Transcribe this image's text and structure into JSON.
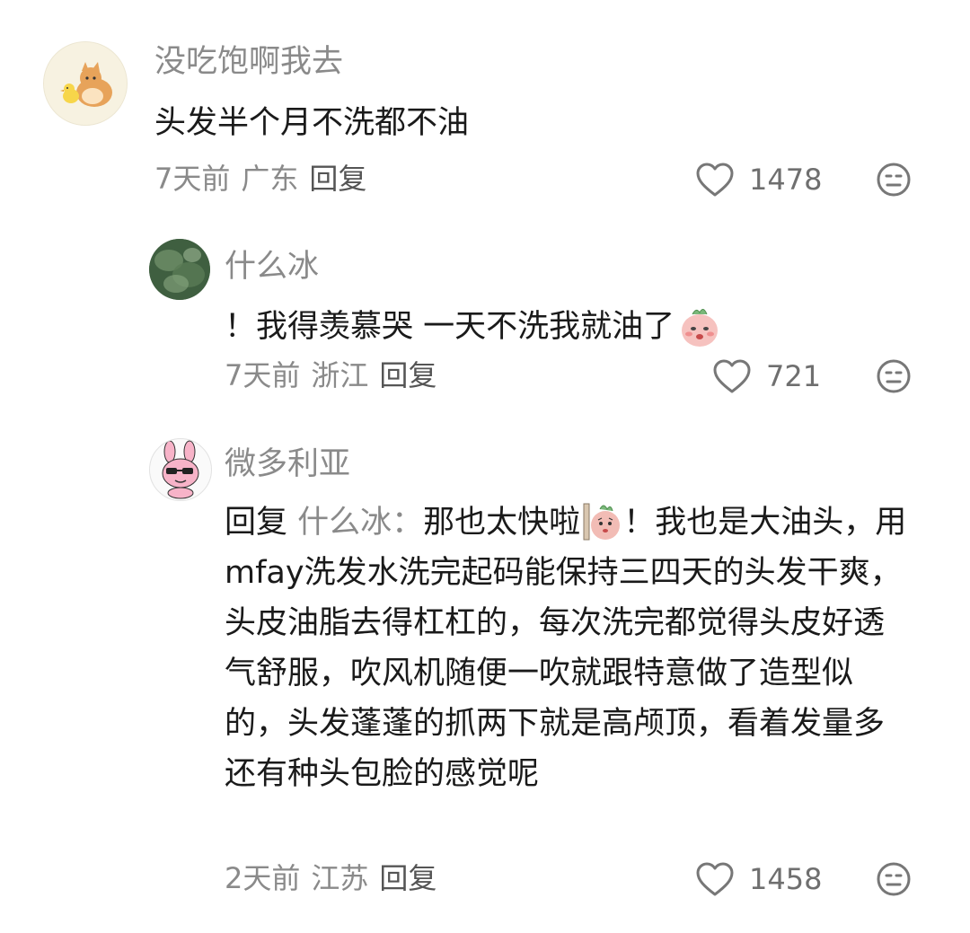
{
  "comments": [
    {
      "username": "没吃饱啊我去",
      "text": "头发半个月不洗都不油",
      "time": "7天前",
      "location": "广东",
      "reply_label": "回复",
      "likes": "1478",
      "avatar": "cat-and-chick-avatar"
    },
    {
      "username": "什么冰",
      "text_before": "！我得羡慕哭 一天不洗我就油了",
      "sticker": "crying-radish-sticker",
      "time": "7天前",
      "location": "浙江",
      "reply_label": "回复",
      "likes": "721",
      "avatar": "green-foliage-avatar"
    },
    {
      "username": "微多利亚",
      "reply_prefix": "回复",
      "reply_to": "什么冰：",
      "text_part1": "那也太快啦",
      "sticker": "peeking-radish-sticker",
      "text_part2": "！我也是大油头，用mfay洗发水洗完起码能保持三四天的头发干爽，头皮油脂去得杠杠的，每次洗完都觉得头皮好透气舒服，吹风机随便一吹就跟特意做了造型似的，头发蓬蓬的抓两下就是高颅顶，看着发量多还有种头包脸的感觉呢",
      "time": "2天前",
      "location": "江苏",
      "reply_label": "回复",
      "likes": "1458",
      "avatar": "pink-bunny-sunglasses-avatar"
    }
  ],
  "colors": {
    "text": "#1a1a1a",
    "muted": "#8a8a8a",
    "icon": "#777777"
  },
  "icons": {
    "like": "heart-outline-icon",
    "dislike": "neutral-face-icon"
  }
}
